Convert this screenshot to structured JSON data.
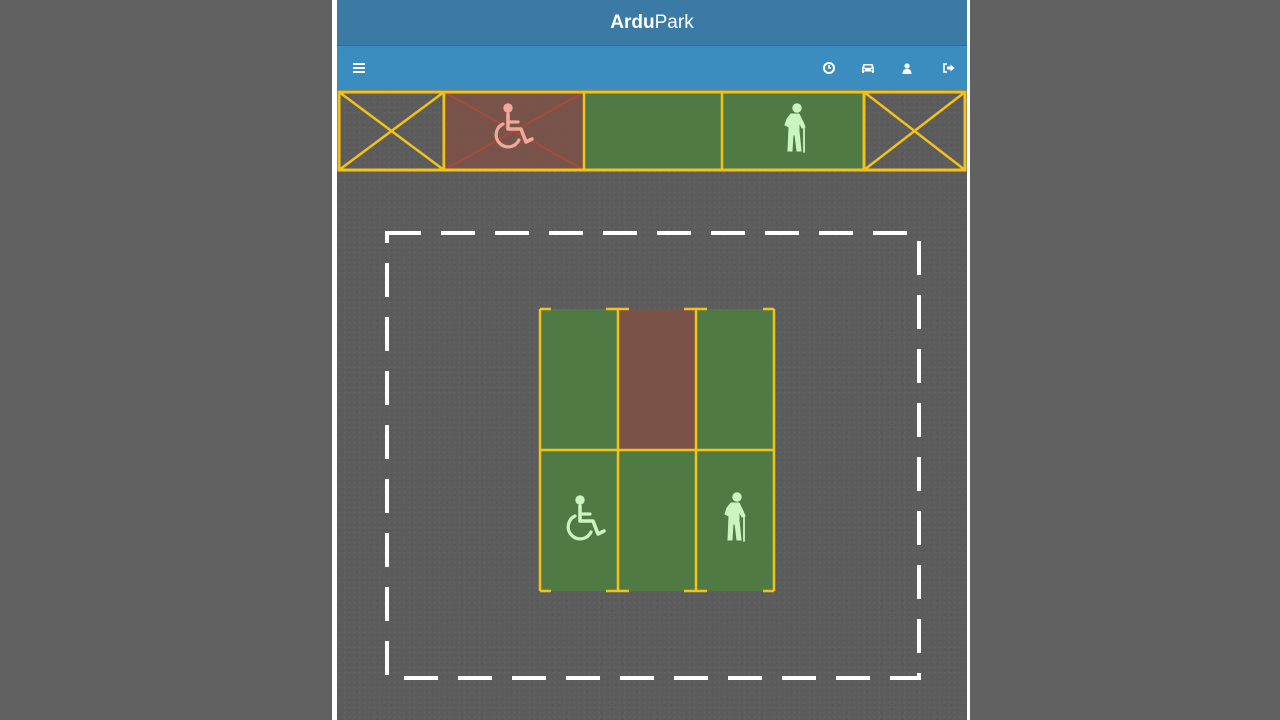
{
  "app": {
    "title_bold": "Ardu",
    "title_rest": "Park"
  },
  "navbar": {
    "menu_icon": "bars-icon",
    "right_icons": [
      "clock-icon",
      "car-icon",
      "user-icon",
      "sign-out-icon"
    ]
  },
  "colors": {
    "header_dark": "#3a7aa4",
    "header_light": "#3c8dbf",
    "asphalt": "#5c5c5c",
    "spot_free": "#4f7a44",
    "spot_occupied": "#7a5248",
    "line_yellow": "#f2c21b",
    "icon_free": "#c9f5c0",
    "icon_occupied": "#f0a89c"
  },
  "top_row_spots": [
    {
      "status": "blocked",
      "icon": "none"
    },
    {
      "status": "occupied",
      "icon": "wheelchair-icon"
    },
    {
      "status": "free",
      "icon": "none"
    },
    {
      "status": "free",
      "icon": "elderly-person-icon"
    },
    {
      "status": "blocked",
      "icon": "none"
    }
  ],
  "center_block_spots": [
    {
      "row": 1,
      "col": 1,
      "status": "free",
      "icon": "none"
    },
    {
      "row": 1,
      "col": 2,
      "status": "occupied",
      "icon": "none"
    },
    {
      "row": 1,
      "col": 3,
      "status": "free",
      "icon": "none"
    },
    {
      "row": 2,
      "col": 1,
      "status": "free",
      "icon": "wheelchair-icon"
    },
    {
      "row": 2,
      "col": 2,
      "status": "free",
      "icon": "none"
    },
    {
      "row": 2,
      "col": 3,
      "status": "free",
      "icon": "elderly-person-icon"
    }
  ]
}
